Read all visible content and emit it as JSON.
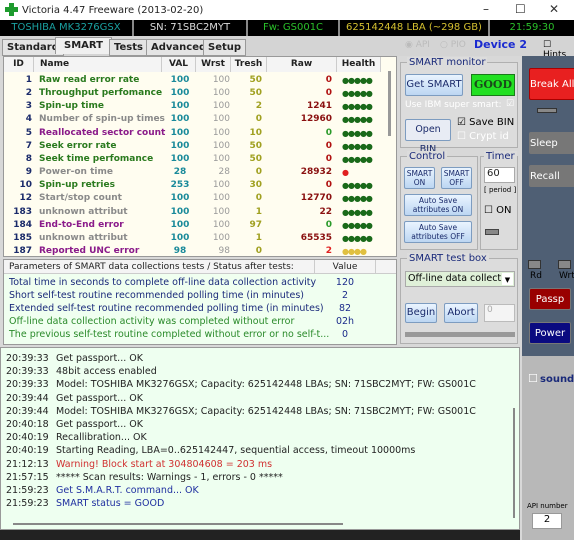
{
  "window": {
    "title": "Victoria 4.47  Freeware (2013-02-20)"
  },
  "info": {
    "model": "TOSHIBA MK3276GSX",
    "sn": "SN: 71SBC2MYT",
    "fw": "Fw: GS001C",
    "lba": "625142448 LBA (~298 GB)",
    "time": "21:59:30"
  },
  "tabs": [
    "Standard",
    "SMART",
    "Tests",
    "Advanced",
    "Setup"
  ],
  "mode": {
    "api": "API",
    "pio": "PIO",
    "device": "Device 2",
    "hints": "Hints"
  },
  "table": {
    "headers": [
      "ID",
      "Name",
      "VAL",
      "Wrst",
      "Tresh",
      "Raw",
      "Health"
    ],
    "rows": [
      {
        "id": "1",
        "name": "Raw read error rate",
        "val": "100",
        "wrst": "100",
        "tresh": "50",
        "raw": "0",
        "health": "●●●●●",
        "kind": "green"
      },
      {
        "id": "2",
        "name": "Throughput perfomance",
        "val": "100",
        "wrst": "100",
        "tresh": "50",
        "raw": "0",
        "health": "●●●●●",
        "kind": "green"
      },
      {
        "id": "3",
        "name": "Spin-up time",
        "val": "100",
        "wrst": "100",
        "tresh": "2",
        "raw": "1241",
        "health": "●●●●●",
        "kind": "green"
      },
      {
        "id": "4",
        "name": "Number of spin-up times",
        "val": "100",
        "wrst": "100",
        "tresh": "0",
        "raw": "12960",
        "health": "●●●●●",
        "kind": "gray"
      },
      {
        "id": "5",
        "name": "Reallocated sector count",
        "val": "100",
        "wrst": "100",
        "tresh": "10",
        "raw": "0",
        "health": "●●●●●",
        "kind": "purple"
      },
      {
        "id": "7",
        "name": "Seek error rate",
        "val": "100",
        "wrst": "100",
        "tresh": "50",
        "raw": "0",
        "health": "●●●●●",
        "kind": "green"
      },
      {
        "id": "8",
        "name": "Seek time perfomance",
        "val": "100",
        "wrst": "100",
        "tresh": "50",
        "raw": "0",
        "health": "●●●●●",
        "kind": "green"
      },
      {
        "id": "9",
        "name": "Power-on time",
        "val": "28",
        "wrst": "28",
        "tresh": "0",
        "raw": "28932",
        "health": "●",
        "kind": "gray"
      },
      {
        "id": "10",
        "name": "Spin-up retries",
        "val": "253",
        "wrst": "100",
        "tresh": "30",
        "raw": "0",
        "health": "●●●●●",
        "kind": "green"
      },
      {
        "id": "12",
        "name": "Start/stop count",
        "val": "100",
        "wrst": "100",
        "tresh": "0",
        "raw": "12770",
        "health": "●●●●●",
        "kind": "gray"
      },
      {
        "id": "183",
        "name": "unknown attribut",
        "val": "100",
        "wrst": "100",
        "tresh": "1",
        "raw": "22",
        "health": "●●●●●",
        "kind": "gray"
      },
      {
        "id": "184",
        "name": "End-to-End error",
        "val": "100",
        "wrst": "100",
        "tresh": "97",
        "raw": "0",
        "health": "●●●●●",
        "kind": "purple"
      },
      {
        "id": "185",
        "name": "unknown attribut",
        "val": "100",
        "wrst": "100",
        "tresh": "1",
        "raw": "65535",
        "health": "●●●●●",
        "kind": "gray"
      },
      {
        "id": "187",
        "name": "Reported UNC error",
        "val": "98",
        "wrst": "98",
        "tresh": "0",
        "raw": "2",
        "health": "●●●●",
        "kind": "purple"
      }
    ]
  },
  "params": {
    "header": "Parameters of SMART data collections tests / Status after tests:",
    "value_header": "Value",
    "rows": [
      {
        "label": "Total time in seconds to complete off-line data collection activity",
        "value": "120",
        "ok": false
      },
      {
        "label": "Short self-test routine recommended polling time (in minutes)",
        "value": "2",
        "ok": false
      },
      {
        "label": "Extended self-test routine recommended polling time (in minutes)",
        "value": "82",
        "ok": false
      },
      {
        "label": "Off-line data collection activity was completed without error",
        "value": "02h",
        "ok": true
      },
      {
        "label": "The previous self-test routine completed without error or no self-t...",
        "value": "0",
        "ok": true
      }
    ]
  },
  "monitor": {
    "title": "SMART monitor",
    "get": "Get SMART",
    "status": "GOOD",
    "ibm": "Use IBM super smart:",
    "open": "Open BIN",
    "save": "Save BIN",
    "crypt": "Crypt id"
  },
  "control": {
    "title": "Control",
    "on": "SMART ON",
    "off": "SMART OFF",
    "auto_on": "Auto Save attributes ON",
    "auto_off": "Auto Save attributes OFF"
  },
  "timer": {
    "title": "Timer",
    "value": "60",
    "period": "[ period ]",
    "on": "ON"
  },
  "testbox": {
    "title": "SMART test box",
    "selected": "Off-line data collect",
    "begin": "Begin",
    "abort": "Abort",
    "field": "0"
  },
  "side": {
    "break": "Break All",
    "sleep": "Sleep",
    "recall": "Recall",
    "rd": "Rd",
    "wr": "Wrt",
    "passp": "Passp",
    "power": "Power",
    "sound": "sound",
    "api_number": "API number",
    "api_value": "2"
  },
  "log": [
    {
      "t": "20:39:33",
      "m": "Get passport... OK",
      "c": "#222"
    },
    {
      "t": "20:39:33",
      "m": "48bit access enabled",
      "c": "#222"
    },
    {
      "t": "20:39:33",
      "m": "Model: TOSHIBA MK3276GSX; Capacity: 625142448 LBAs; SN: 71SBC2MYT; FW: GS001C",
      "c": "#222"
    },
    {
      "t": "20:39:44",
      "m": "Get passport... OK",
      "c": "#222"
    },
    {
      "t": "20:39:44",
      "m": "Model: TOSHIBA MK3276GSX; Capacity: 625142448 LBAs; SN: 71SBC2MYT; FW: GS001C",
      "c": "#222"
    },
    {
      "t": "20:40:18",
      "m": "Get passport... OK",
      "c": "#222"
    },
    {
      "t": "20:40:19",
      "m": "Recallibration... OK",
      "c": "#222"
    },
    {
      "t": "20:40:19",
      "m": "Starting Reading, LBA=0..625142447, sequential access, timeout 10000ms",
      "c": "#222"
    },
    {
      "t": "21:12:13",
      "m": "Warning! Block start at 304804608 = 203 ms",
      "c": "#d03030"
    },
    {
      "t": "21:57:15",
      "m": "***** Scan results: Warnings - 1, errors - 0 *****",
      "c": "#222"
    },
    {
      "t": "21:59:23",
      "m": "Get S.M.A.R.T. command... OK",
      "c": "#2030a0"
    },
    {
      "t": "21:59:23",
      "m": "SMART status = GOOD",
      "c": "#2030a0"
    }
  ]
}
